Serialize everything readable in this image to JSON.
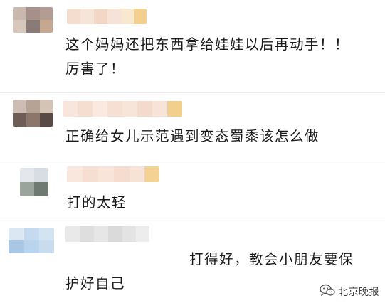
{
  "comments": [
    {
      "username_obscured": true,
      "avatar_obscured": true,
      "lines": [
        "这个妈妈还把东西拿给娃娃以后再动手！！",
        "厉害了！"
      ]
    },
    {
      "username_obscured": true,
      "avatar_obscured": true,
      "lines": [
        "正确给女儿示范遇到变态蜀黍该怎么做"
      ]
    },
    {
      "username_obscured": true,
      "avatar_obscured": true,
      "lines": [
        "打的太轻"
      ]
    },
    {
      "username_obscured": true,
      "avatar_obscured": true,
      "lines": [
        "打得好，教会小朋友要保",
        "护好自己"
      ]
    }
  ],
  "watermark": {
    "text": "北京晚报",
    "icon": "wechat-icon"
  },
  "colors": {
    "text": "#1a1a1a",
    "divider": "#ececec",
    "mosaic_warm": "#f5d6b8",
    "mosaic_blue": "#b9d4ec"
  }
}
